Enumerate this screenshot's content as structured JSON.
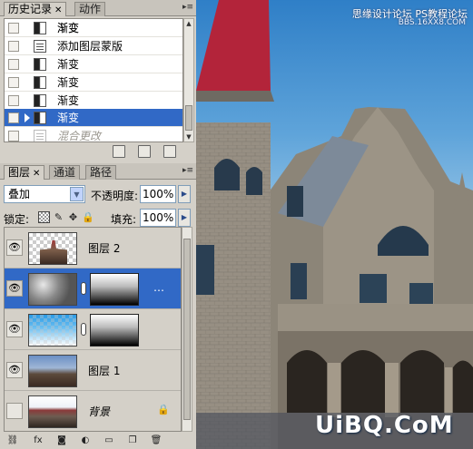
{
  "history_panel": {
    "tabs": [
      "历史记录",
      "动作"
    ],
    "rows": [
      {
        "label": "渐变",
        "icon": "gradient-icon",
        "state": "normal"
      },
      {
        "label": "渐变",
        "icon": "gradient-icon",
        "state": "normal"
      },
      {
        "label": "添加图层蒙版",
        "icon": "document-icon",
        "state": "normal"
      },
      {
        "label": "渐变",
        "icon": "gradient-icon",
        "state": "normal"
      },
      {
        "label": "渐变",
        "icon": "gradient-icon",
        "state": "normal"
      },
      {
        "label": "渐变",
        "icon": "gradient-icon",
        "state": "normal"
      },
      {
        "label": "渐变",
        "icon": "gradient-icon",
        "state": "selected"
      },
      {
        "label": "混合更改",
        "icon": "document-icon",
        "state": "greyed"
      }
    ]
  },
  "layers_panel": {
    "tabs": [
      "图层",
      "通道",
      "路径"
    ],
    "blend_mode": "叠加",
    "opacity_label": "不透明度:",
    "opacity_value": "100%",
    "lock_label": "锁定:",
    "fill_label": "填充:",
    "fill_value": "100%",
    "layers": [
      {
        "name": "图层 2",
        "visible": true,
        "selected": false,
        "thumbnail": "castle-cutout",
        "has_mask": false
      },
      {
        "name": "",
        "visible": true,
        "selected": true,
        "thumbnail": "clouds",
        "has_mask": true,
        "suffix": "…"
      },
      {
        "name": "",
        "visible": true,
        "selected": false,
        "thumbnail": "sky-gradient",
        "has_mask": true
      },
      {
        "name": "图层 1",
        "visible": true,
        "selected": false,
        "thumbnail": "castle",
        "has_mask": false
      },
      {
        "name": "背景",
        "visible": false,
        "selected": false,
        "thumbnail": "castle-white-sky",
        "has_mask": false,
        "locked": true
      }
    ]
  },
  "canvas": {
    "watermark_top": "思缘设计论坛",
    "watermark_top_right": "PS教程论坛",
    "watermark_sub": "BBS.16XX8.COM",
    "watermark_logo": "UiBQ.CoM"
  },
  "colors": {
    "selection_blue": "#3169c6",
    "panel_grey": "#d4d0c8",
    "roof_red": "#b3243a",
    "sky_blue": "#2f7fc7"
  }
}
